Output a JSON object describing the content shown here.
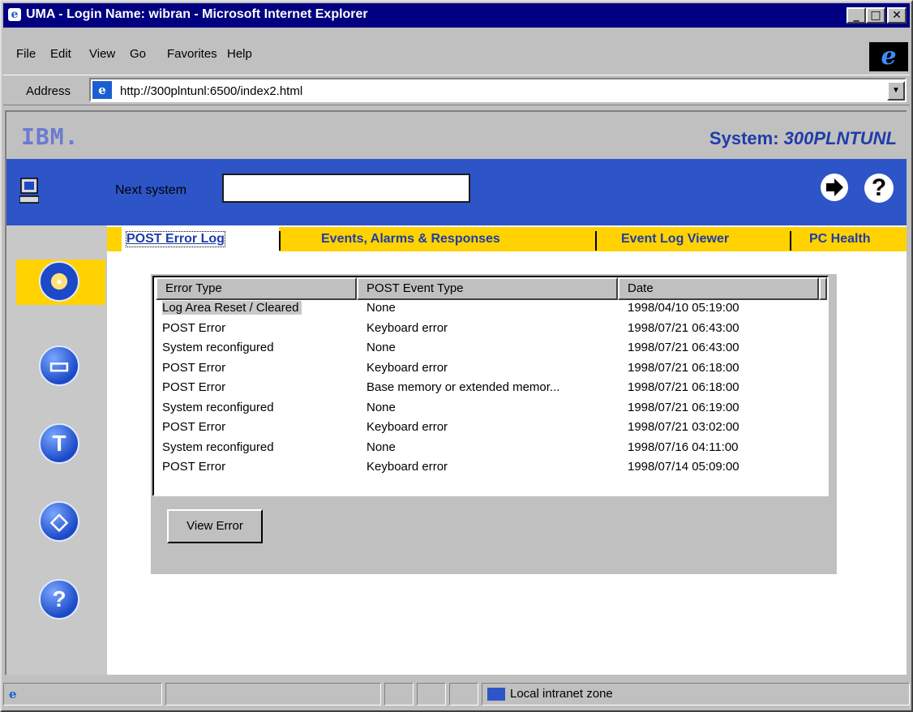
{
  "window": {
    "title": "UMA - Login Name: wibran - Microsoft Internet Explorer"
  },
  "menu": {
    "items": [
      "File",
      "Edit",
      "View",
      "Go",
      "Favorites",
      "Help"
    ]
  },
  "address": {
    "label": "Address",
    "url": "http://300plntunl:6500/index2.html"
  },
  "header": {
    "logo": "IBM.",
    "system_label": "System:",
    "system_name": "300PLNTUNL"
  },
  "toolbar": {
    "next_system_label": "Next system",
    "next_system_value": ""
  },
  "tabs": [
    {
      "label": "POST Error Log",
      "active": true
    },
    {
      "label": "Events, Alarms & Responses",
      "active": false
    },
    {
      "label": "Event Log Viewer",
      "active": false
    },
    {
      "label": "PC Health",
      "active": false
    }
  ],
  "sidebar": {
    "icons": [
      "clock-icon",
      "computer-icon",
      "tools-icon",
      "network-icon",
      "search-icon"
    ]
  },
  "table": {
    "columns": [
      "Error Type",
      "POST Event Type",
      "Date"
    ],
    "rows": [
      [
        "Log Area Reset / Cleared",
        "None",
        "1998/04/10 05:19:00"
      ],
      [
        "POST Error",
        "Keyboard error",
        "1998/07/21 06:43:00"
      ],
      [
        "System reconfigured",
        "None",
        "1998/07/21 06:43:00"
      ],
      [
        "POST Error",
        "Keyboard error",
        "1998/07/21 06:18:00"
      ],
      [
        "POST Error",
        "Base memory or extended memor...",
        "1998/07/21 06:18:00"
      ],
      [
        "System reconfigured",
        "None",
        "1998/07/21 06:19:00"
      ],
      [
        "POST Error",
        "Keyboard error",
        "1998/07/21 03:02:00"
      ],
      [
        "System reconfigured",
        "None",
        "1998/07/16 04:11:00"
      ],
      [
        "POST Error",
        "Keyboard error",
        "1998/07/14 05:09:00"
      ]
    ],
    "selected_row": 0
  },
  "actions": {
    "view_error_label": "View Error"
  },
  "status": {
    "zone": "Local intranet zone"
  },
  "colors": {
    "titlebar": "#000080",
    "bluebar": "#2d55c8",
    "tabbar": "#ffd200",
    "tab_text": "#1f3ca8"
  }
}
